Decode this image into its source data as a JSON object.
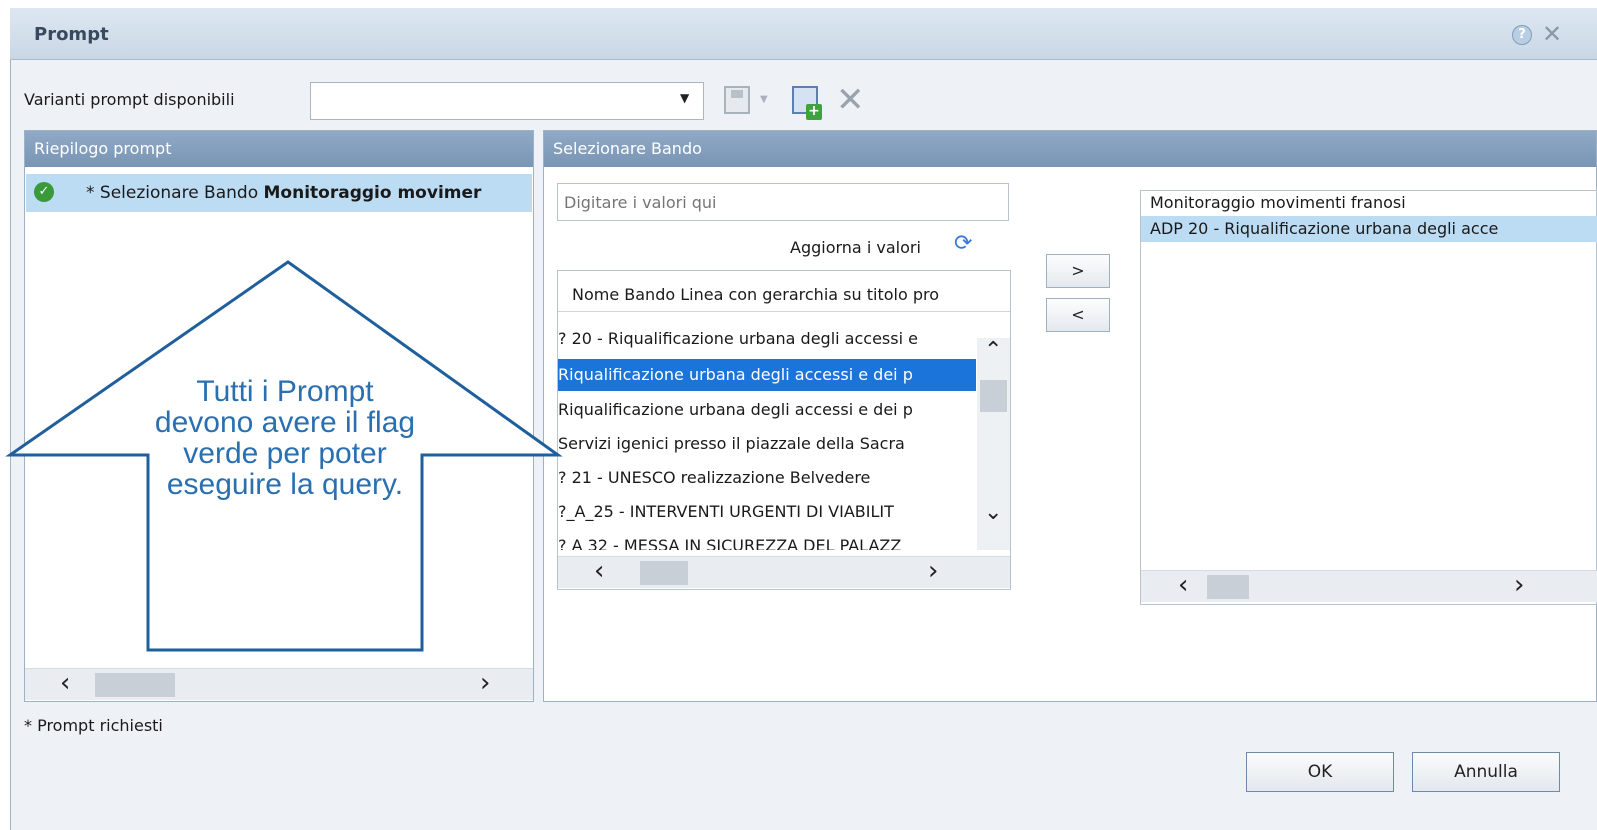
{
  "dialog": {
    "title": "Prompt",
    "help_icon": "help-icon",
    "close_icon": "close-icon"
  },
  "variants": {
    "label": "Varianti prompt disponibili",
    "value": "",
    "save_icon": "save-icon",
    "save_as_icon": "save-as-icon",
    "delete_icon": "delete-icon"
  },
  "summary": {
    "header": "Riepilogo prompt",
    "item_prefix": "* Selezionare Bando ",
    "item_value": "Monitoraggio movimer",
    "status_icon": "check-icon"
  },
  "bando": {
    "header": "Selezionare Bando",
    "search_placeholder": "Digitare i valori qui",
    "refresh_label": "Aggiorna i valori",
    "column_header": "Nome Bando Linea con gerarchia su titolo pro",
    "rows": [
      "? 20 - Riqualificazione urbana degli accessi e",
      "Riqualificazione urbana degli accessi e dei p",
      "Riqualificazione urbana degli accessi e dei p",
      "Servizi igenici presso il piazzale della Sacra",
      "? 21 - UNESCO realizzazione Belvedere",
      "?_A_25 - INTERVENTI URGENTI DI VIABILIT",
      "? A 32 - MESSA IN SICUREZZA DEL PALAZZ"
    ],
    "selected_row_index": 1,
    "add_label": ">",
    "remove_label": "<"
  },
  "selected_values": [
    "Monitoraggio movimenti franosi",
    "ADP 20 - Riqualificazione urbana degli acce"
  ],
  "footer": {
    "required_note": "* Prompt richiesti",
    "ok_label": "OK",
    "cancel_label": "Annulla"
  },
  "callout": {
    "text": "Tutti i Prompt devono avere il flag verde per poter eseguire la query."
  },
  "colors": {
    "header_blue": "#7a95b5",
    "selection_blue": "#1b74d9",
    "highlight": "#bcdcf4",
    "check_green": "#3a9a3a",
    "callout_blue": "#2a6fb0"
  }
}
